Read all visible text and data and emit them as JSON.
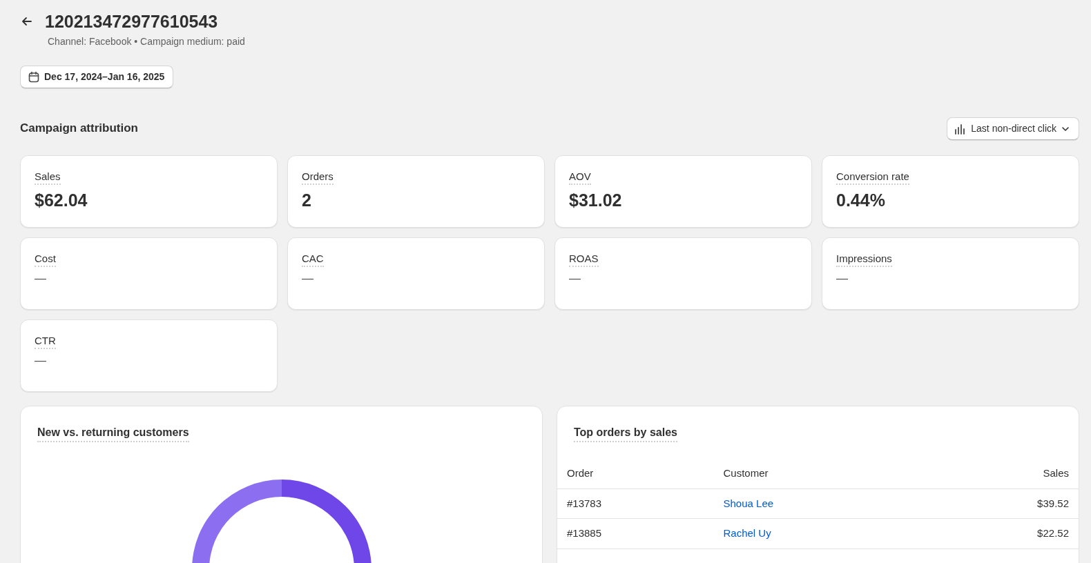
{
  "header": {
    "title": "120213472977610543",
    "subtitle": "Channel: Facebook • Campaign medium: paid"
  },
  "date_range": {
    "label": "Dec 17, 2024–Jan 16, 2025"
  },
  "section": {
    "title": "Campaign attribution",
    "model_button": "Last non-direct click"
  },
  "metrics": [
    {
      "label": "Sales",
      "value": "$62.04",
      "kind": "amount"
    },
    {
      "label": "Orders",
      "value": "2",
      "kind": "amount"
    },
    {
      "label": "AOV",
      "value": "$31.02",
      "kind": "amount"
    },
    {
      "label": "Conversion rate",
      "value": "0.44%",
      "kind": "amount"
    },
    {
      "label": "Cost",
      "value": "—",
      "kind": "blank"
    },
    {
      "label": "CAC",
      "value": "—",
      "kind": "blank"
    },
    {
      "label": "ROAS",
      "value": "—",
      "kind": "blank"
    },
    {
      "label": "Impressions",
      "value": "—",
      "kind": "blank"
    },
    {
      "label": "CTR",
      "value": "—",
      "kind": "blank"
    }
  ],
  "customers_card": {
    "title": "New vs. returning customers"
  },
  "top_orders": {
    "title": "Top orders by sales",
    "columns": [
      "Order",
      "Customer",
      "Sales"
    ],
    "rows": [
      {
        "order": "#13783",
        "customer": "Shoua Lee",
        "sales": "$39.52"
      },
      {
        "order": "#13885",
        "customer": "Rachel Uy",
        "sales": "$22.52"
      }
    ]
  }
}
